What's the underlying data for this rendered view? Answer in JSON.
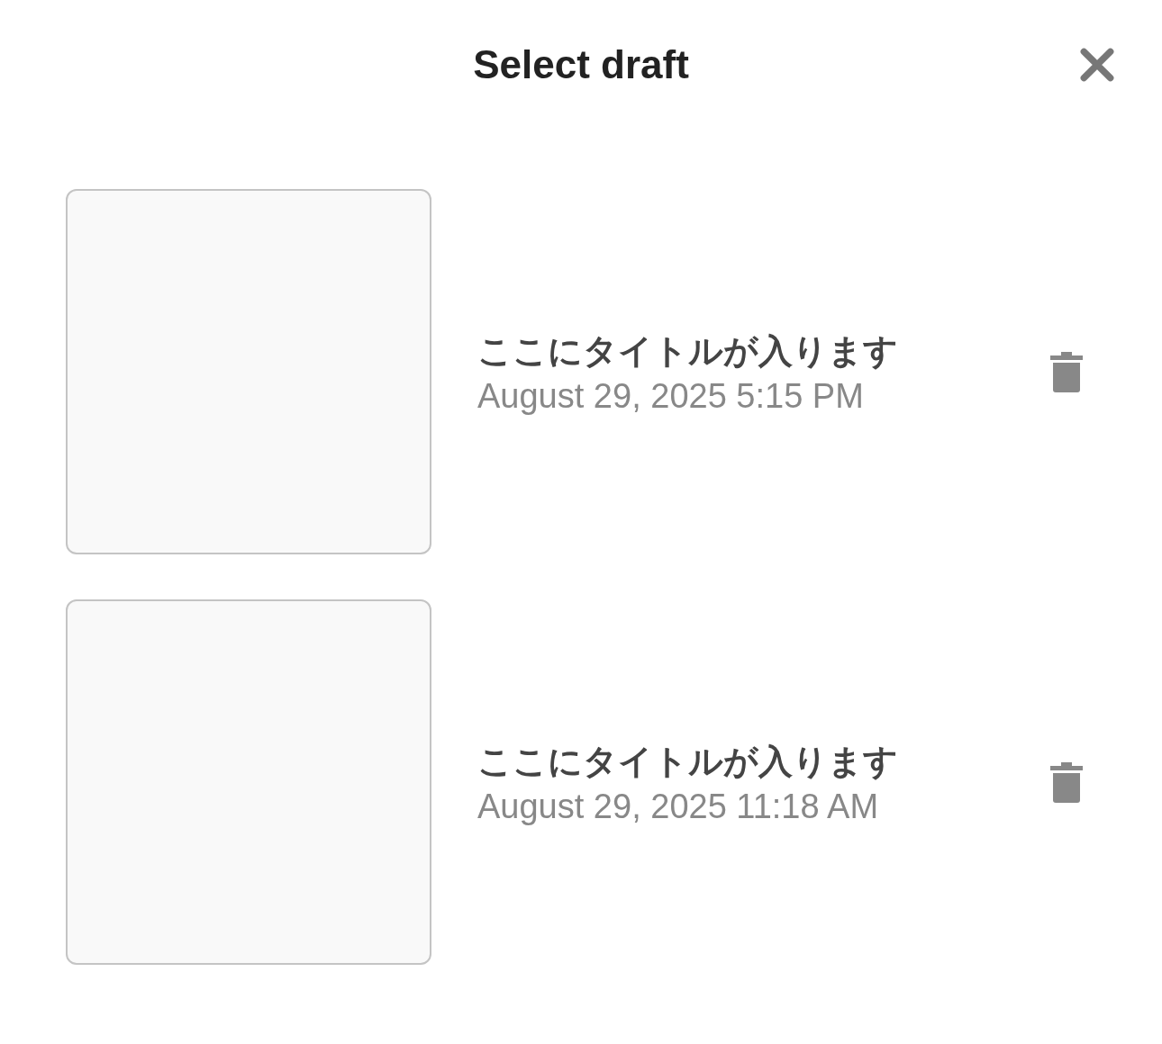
{
  "header": {
    "title": "Select draft"
  },
  "drafts": [
    {
      "title": "ここにタイトルが入ります",
      "date": "August 29, 2025 5:15 PM"
    },
    {
      "title": "ここにタイトルが入ります",
      "date": "August 29, 2025 11:18 AM"
    }
  ]
}
